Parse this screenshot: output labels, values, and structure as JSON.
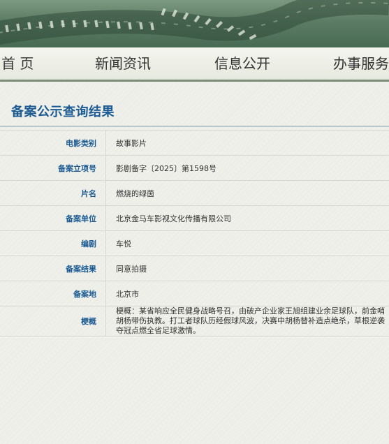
{
  "nav": {
    "home": "首 页",
    "news": "新闻资讯",
    "info": "信息公开",
    "service": "办事服务"
  },
  "page_title": "备案公示查询结果",
  "records": [
    {
      "label": "电影类别",
      "value": "故事影片"
    },
    {
      "label": "备案立项号",
      "value": "影剧备字〔2025〕第1598号"
    },
    {
      "label": "片名",
      "value": "燃烧的绿茵"
    },
    {
      "label": "备案单位",
      "value": "北京金马车影视文化传播有限公司"
    },
    {
      "label": "编剧",
      "value": "车悦"
    },
    {
      "label": "备案结果",
      "value": "同意拍摄"
    },
    {
      "label": "备案地",
      "value": "北京市"
    },
    {
      "label": "梗概",
      "value": "梗概：某省响应全民健身战略号召，由破产企业家王旭组建业余足球队，前金哨胡杨带伤执教。打工者球队历经假球风波，决赛中胡杨替补造点绝杀，草根逆袭夺冠点燃全省足球激情。"
    }
  ],
  "colors": {
    "title": "#1d5b94",
    "label": "#1d5b94",
    "banner": "#5d7c65"
  }
}
